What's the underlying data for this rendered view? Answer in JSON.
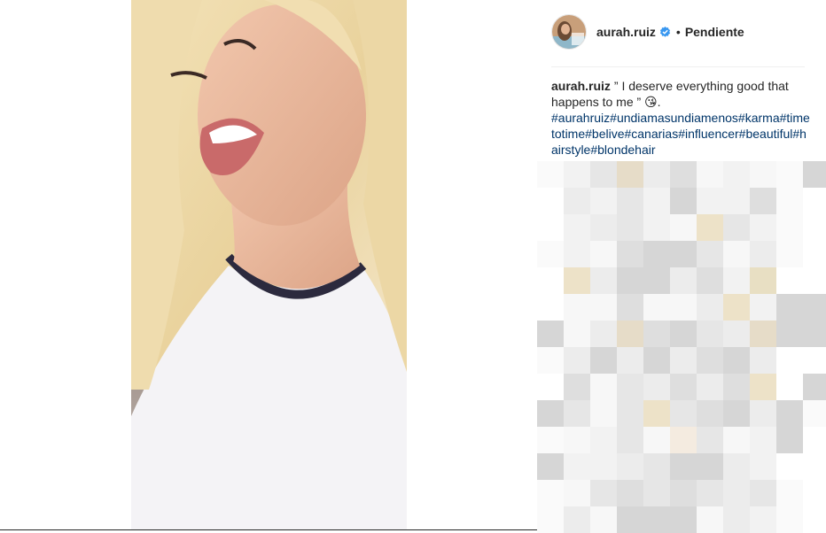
{
  "post": {
    "username": "aurah.ruiz",
    "status": "Pendiente",
    "status_separator": "•",
    "caption_user": "aurah.ruiz",
    "caption_text": "” I deserve everything good that happens to me ” 😘.",
    "hashtags": "#aurahruiz#undiamasundiamenos#karma#timetotime#belive#canarias#influencer#beautiful#hairstyle#blondehair"
  },
  "icons": {
    "verified": "verified-badge-icon"
  },
  "colors": {
    "hashtag": "#003569",
    "verified": "#3897f0",
    "text": "#262626"
  }
}
